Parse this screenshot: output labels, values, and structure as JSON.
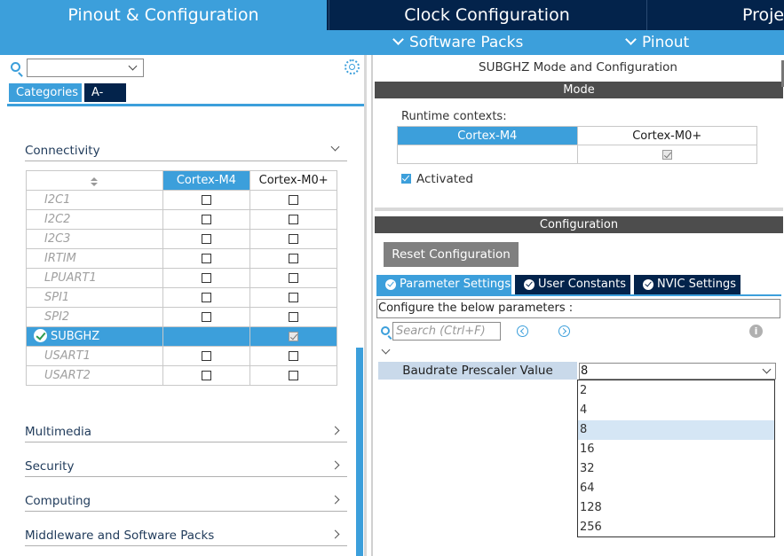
{
  "top_tabs": [
    {
      "label": "Pinout & Configuration",
      "active": true
    },
    {
      "label": "Clock Configuration",
      "active": false
    },
    {
      "label": "Proje",
      "active": false
    }
  ],
  "sub_menu": {
    "software_packs": "Software Packs",
    "pinout": "Pinout"
  },
  "left": {
    "search_value": "",
    "tabs": {
      "categories": "Categories",
      "az": "A->Z"
    },
    "groups": {
      "connectivity": "Connectivity",
      "multimedia": "Multimedia",
      "security": "Security",
      "computing": "Computing",
      "middleware": "Middleware and Software Packs"
    },
    "table": {
      "col_m4": "Cortex-M4",
      "col_m0": "Cortex-M0+",
      "rows": [
        {
          "name": "I2C1",
          "selected": false
        },
        {
          "name": "I2C2",
          "selected": false
        },
        {
          "name": "I2C3",
          "selected": false
        },
        {
          "name": "IRTIM",
          "selected": false
        },
        {
          "name": "LPUART1",
          "selected": false
        },
        {
          "name": "SPI1",
          "selected": false
        },
        {
          "name": "SPI2",
          "selected": false
        },
        {
          "name": "SUBGHZ",
          "selected": true
        },
        {
          "name": "USART1",
          "selected": false
        },
        {
          "name": "USART2",
          "selected": false
        }
      ]
    }
  },
  "right": {
    "title": "SUBGHZ Mode and Configuration",
    "mode_header": "Mode",
    "runtime_contexts_label": "Runtime contexts:",
    "ctx_m4": "Cortex-M4",
    "ctx_m0": "Cortex-M0+",
    "activated": "Activated",
    "config_header": "Configuration",
    "reset_button": "Reset Configuration",
    "param_tabs": [
      "Parameter Settings",
      "User Constants",
      "NVIC Settings"
    ],
    "configure_label": "Configure the below parameters :",
    "search_placeholder": "Search (Ctrl+F)",
    "param_name": "Baudrate Prescaler Value",
    "param_value": "8",
    "options": [
      "2",
      "4",
      "8",
      "16",
      "32",
      "64",
      "128",
      "256"
    ],
    "selected_option": "8"
  }
}
